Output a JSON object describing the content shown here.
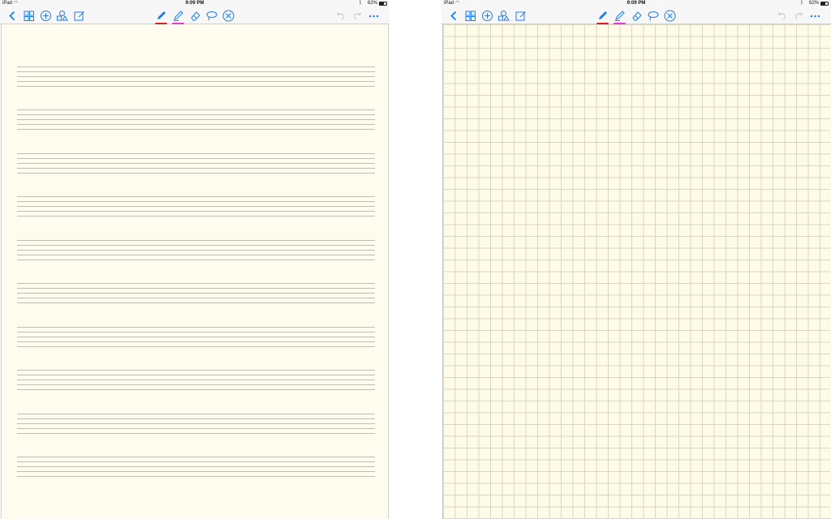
{
  "status_bar": {
    "carrier": "iPad",
    "time": "9:09 PM",
    "battery": "62%",
    "battery_level": 0.62
  },
  "toolbar": {
    "icons": [
      "back-icon",
      "grid-view-icon",
      "add-icon",
      "shapes-icon",
      "edit-icon",
      "pen-icon",
      "highlighter-icon",
      "eraser-icon",
      "lasso-icon",
      "close-icon",
      "undo-icon",
      "redo-icon",
      "more-icon"
    ],
    "pen_color": "#e02020",
    "highlighter_color": "#e03ad0",
    "accent_color": "#1a7bf2"
  },
  "screens": [
    {
      "paper": "music-staff"
    },
    {
      "paper": "grid"
    }
  ]
}
